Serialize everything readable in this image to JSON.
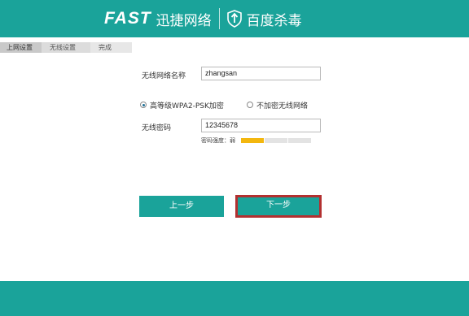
{
  "header": {
    "brand": "FAST",
    "brand_cn": "迅捷网络",
    "partner": "百度杀毒"
  },
  "steps": [
    {
      "label": "上网设置"
    },
    {
      "label": "无线设置"
    },
    {
      "label": "完成"
    }
  ],
  "form": {
    "ssid_label": "无线网络名称",
    "ssid_value": "zhangsan",
    "security_option_label": "高等级WPA2-PSK加密",
    "security_selected": true,
    "none_option_label": "不加密无线网络",
    "password_label": "无线密码",
    "password_value": "12345678",
    "strength_label": "密码强度：弱",
    "strength_level": 0.25
  },
  "buttons": {
    "prev": "上一步",
    "next": "下一步"
  },
  "colors": {
    "teal": "#1aa39a",
    "highlight": "#b33030",
    "strength_fill": "#f3b70f"
  }
}
